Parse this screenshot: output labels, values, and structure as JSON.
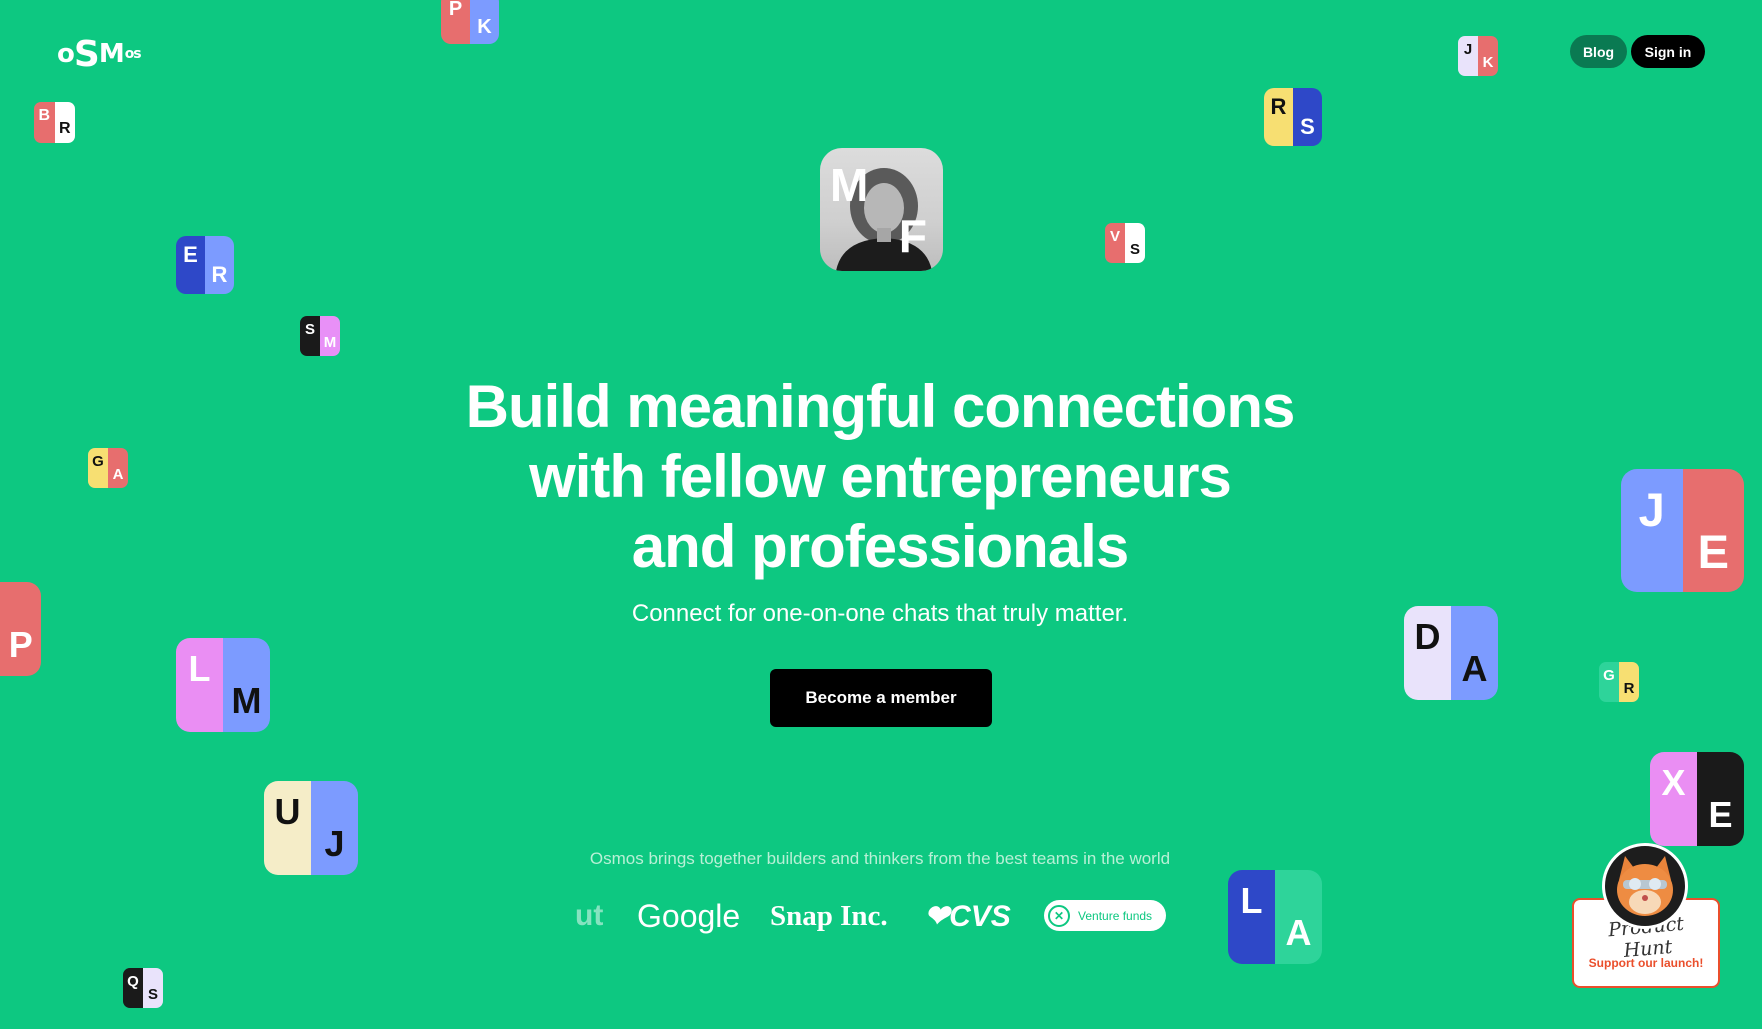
{
  "header": {
    "logo": {
      "p1": "o",
      "p2": "S",
      "p3": "M",
      "p4": "os"
    },
    "blog_label": "Blog",
    "signin_label": "Sign in"
  },
  "hero": {
    "line1": "Build meaningful connections",
    "line2": "with fellow entrepreneurs",
    "line3": "and professionals",
    "subtitle": "Connect for one-on-one chats that truly matter.",
    "cta_label": "Become a member"
  },
  "featured_tile": {
    "top": "M",
    "bottom": "F"
  },
  "teams": {
    "caption": "Osmos brings together builders and thinkers from the best teams in the world",
    "logos": {
      "partial": "ut",
      "google": "Google",
      "snap": "Snap Inc.",
      "cvs": "❤CVS",
      "vf": "Venture funds"
    }
  },
  "product_hunt": {
    "script": "Product Hunt",
    "label": "Support our launch!"
  },
  "tiles": [
    {
      "top": "P",
      "bottom": "K",
      "c1": "#e76e6e",
      "c2": "#7c9bff"
    },
    {
      "top": "B",
      "bottom": "R",
      "c1": "#e76e6e",
      "c2": "#ffffff"
    },
    {
      "top": "E",
      "bottom": "R",
      "c1": "#2e48c8",
      "c2": "#7c9bff"
    },
    {
      "top": "S",
      "bottom": "M",
      "c1": "#1a1a1a",
      "c2": "#e890f7"
    },
    {
      "top": "G",
      "bottom": "A",
      "c1": "#f7df72",
      "c2": "#e76e6e"
    },
    {
      "top": "",
      "bottom": "P",
      "c1": "#e76e6e",
      "c2": "#e76e6e"
    },
    {
      "top": "L",
      "bottom": "M",
      "c1": "#ea8ef3",
      "c2": "#7c9bff"
    },
    {
      "top": "U",
      "bottom": "J",
      "c1": "#f5edc8",
      "c2": "#7c9bff"
    },
    {
      "top": "Q",
      "bottom": "S",
      "c1": "#1a1a1a",
      "c2": "#e9e3fb"
    },
    {
      "top": "J",
      "bottom": "K",
      "c1": "#e9e3fb",
      "c2": "#e76e6e"
    },
    {
      "top": "R",
      "bottom": "S",
      "c1": "#f7df72",
      "c2": "#2e48c8"
    },
    {
      "top": "V",
      "bottom": "S",
      "c1": "#e76e6e",
      "c2": "#ffffff"
    },
    {
      "top": "J",
      "bottom": "E",
      "c1": "#7c9bff",
      "c2": "#e76e6e"
    },
    {
      "top": "D",
      "bottom": "A",
      "c1": "#e9e3fb",
      "c2": "#7c9bff"
    },
    {
      "top": "G",
      "bottom": "R",
      "c1": "#2ed49a",
      "c2": "#f7df72"
    },
    {
      "top": "X",
      "bottom": "E",
      "c1": "#ea8ef3",
      "c2": "#1a1a1a"
    },
    {
      "top": "L",
      "bottom": "A",
      "c1": "#2e48c8",
      "c2": "#2ed49a"
    }
  ]
}
